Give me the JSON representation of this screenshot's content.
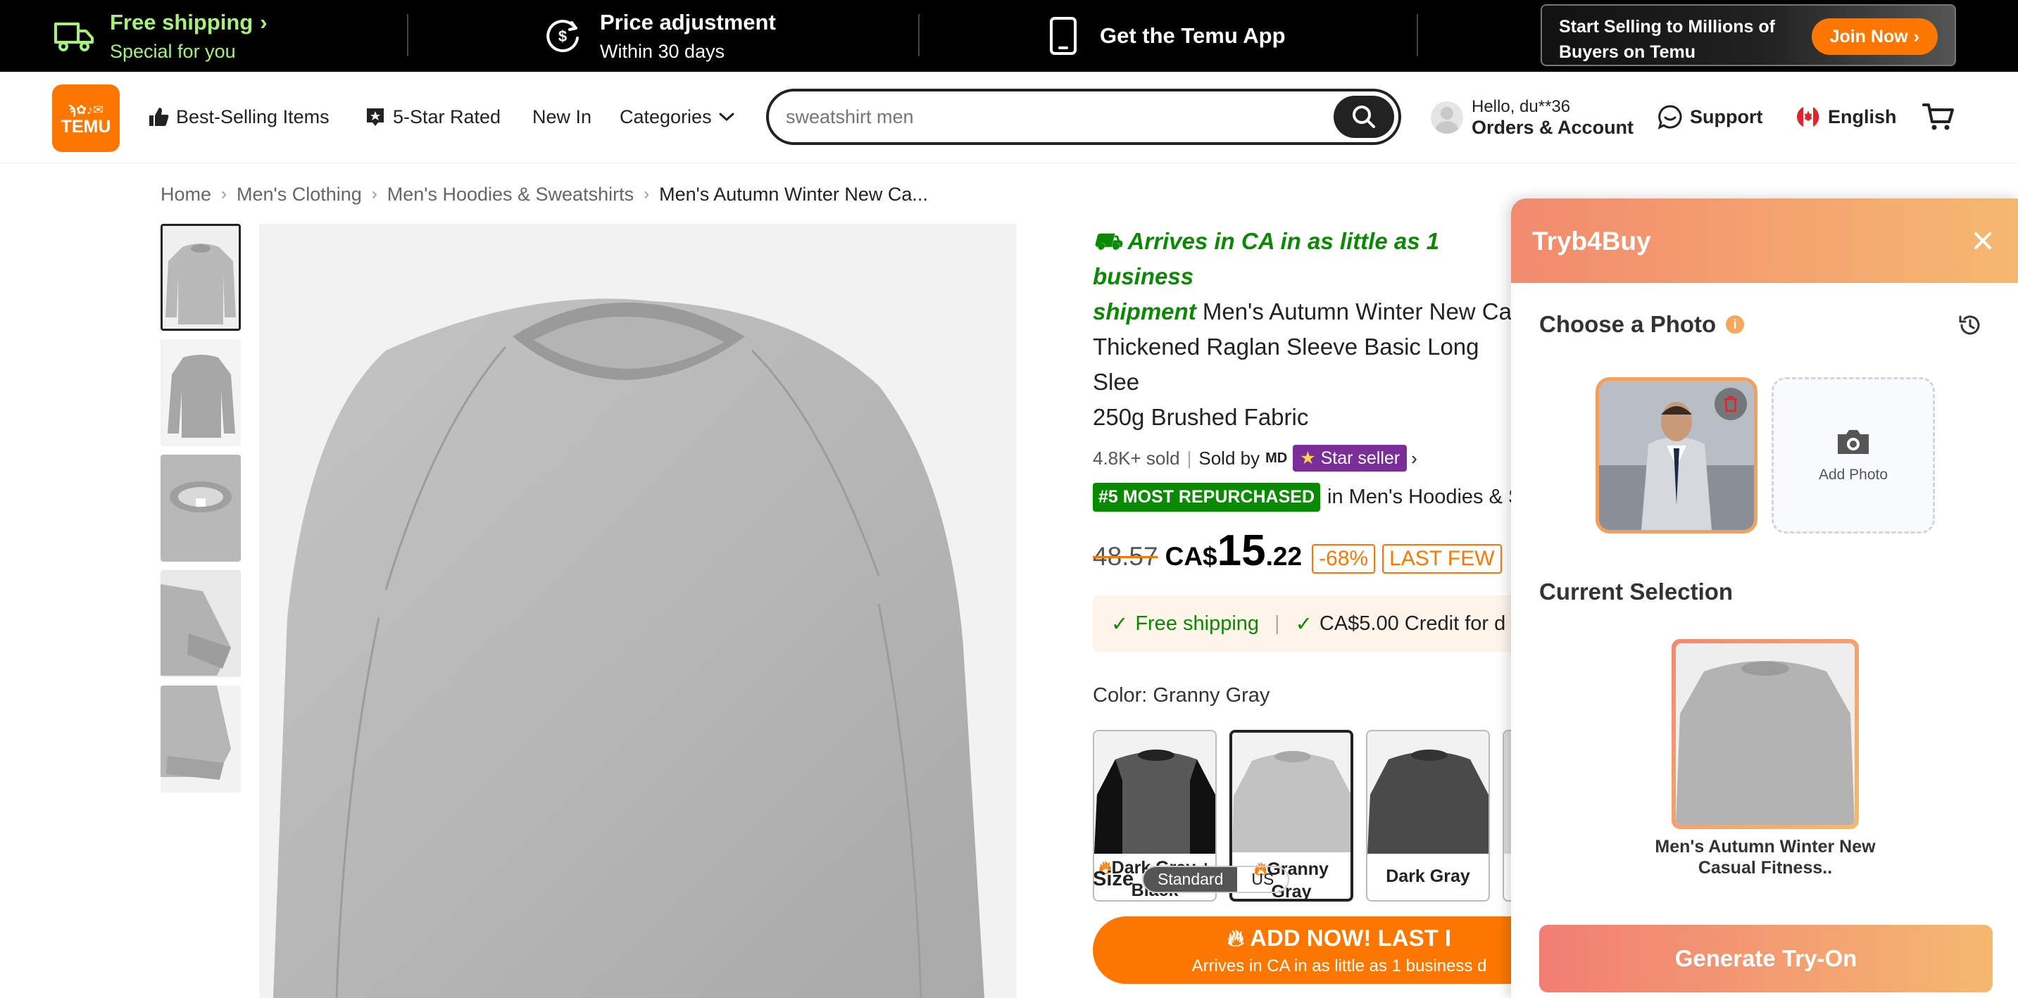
{
  "topbar": {
    "shipping_title": "Free shipping",
    "shipping_sub": "Special for you",
    "price_title": "Price adjustment",
    "price_sub": "Within 30 days",
    "app_title": "Get the Temu App",
    "seller_line1": "Start Selling to Millions of",
    "seller_line2": "Buyers on Temu",
    "join_label": "Join Now"
  },
  "header": {
    "logo_line1": "ϡ✿♪✉",
    "logo_line2": "TEMU",
    "nav": [
      "Best-Selling Items",
      "5-Star Rated",
      "New In",
      "Categories"
    ],
    "search_placeholder": "sweatshirt men",
    "greeting": "Hello, du**36",
    "account_label": "Orders & Account",
    "support_label": "Support",
    "language_label": "English"
  },
  "breadcrumb": [
    "Home",
    "Men's Clothing",
    "Men's Hoodies & Sweatshirts",
    "Men's Autumn Winter New Ca..."
  ],
  "product": {
    "arrives_green": "Arrives in CA in as little as 1 business",
    "shipment_green": "shipment",
    "title_tail_1": " Men's Autumn Winter New Ca",
    "title_line2": "Thickened Raglan Sleeve Basic Long Slee",
    "title_line3": "250g Brushed Fabric",
    "sold": "4.8K+ sold",
    "sold_by": "Sold by",
    "seller_mark": "MD",
    "star_seller": "Star seller",
    "repurchased_badge": "#5 MOST REPURCHASED",
    "repurchased_tail": "in Men's Hoodies & S",
    "old_price": "48.57",
    "currency": "CA$",
    "price_int": "15",
    "price_cents": ".22",
    "discount": "-68%",
    "stock_tag": "LAST FEW",
    "free_shipping": "Free shipping",
    "credit": "CA$5.00 Credit for d",
    "color_label": "Color: Granny Gray",
    "swatches": [
      "Dark Gray + Black",
      "Granny Gray",
      "Dark Gray"
    ],
    "size_label": "Size",
    "size_options": [
      "Standard",
      "US"
    ],
    "add_line1": "ADD NOW! LAST I",
    "add_line2": "Arrives in CA in as little as 1 business d"
  },
  "panel": {
    "title": "Tryb4Buy",
    "choose_photo": "Choose a Photo",
    "info_mark": "i",
    "add_photo": "Add Photo",
    "current_selection": "Current Selection",
    "selection_name": "Men's Autumn Winter New Casual Fitness..",
    "generate_label": "Generate Try-On"
  },
  "colors": {
    "accent": "#fb7701",
    "promo_green": "#a6f17d",
    "success_green": "#0a8a00",
    "panel_gradient_start": "#f28a6e",
    "panel_gradient_end": "#f5b870"
  }
}
